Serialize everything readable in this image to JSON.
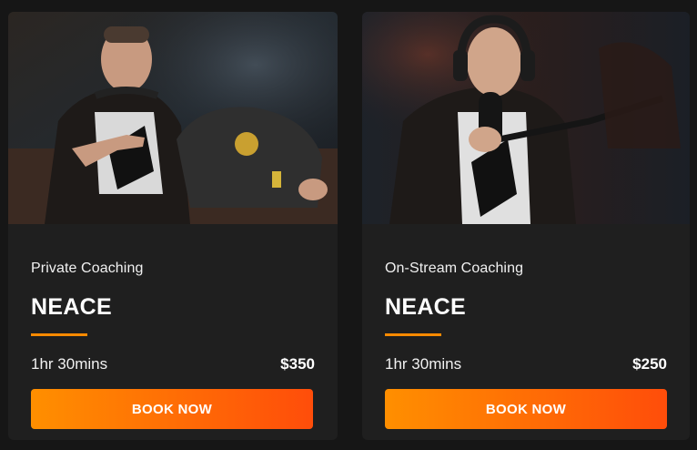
{
  "cards": [
    {
      "type": "Private Coaching",
      "coach": "NEACE",
      "duration": "1hr 30mins",
      "price": "$350",
      "button": "BOOK NOW"
    },
    {
      "type": "On-Stream Coaching",
      "coach": "NEACE",
      "duration": "1hr 30mins",
      "price": "$250",
      "button": "BOOK NOW"
    }
  ],
  "colors": {
    "accent": "#ff8a00",
    "button_start": "#ff8f00",
    "button_end": "#ff4d0a",
    "card_bg": "#1f1f1f",
    "page_bg": "#161616"
  }
}
